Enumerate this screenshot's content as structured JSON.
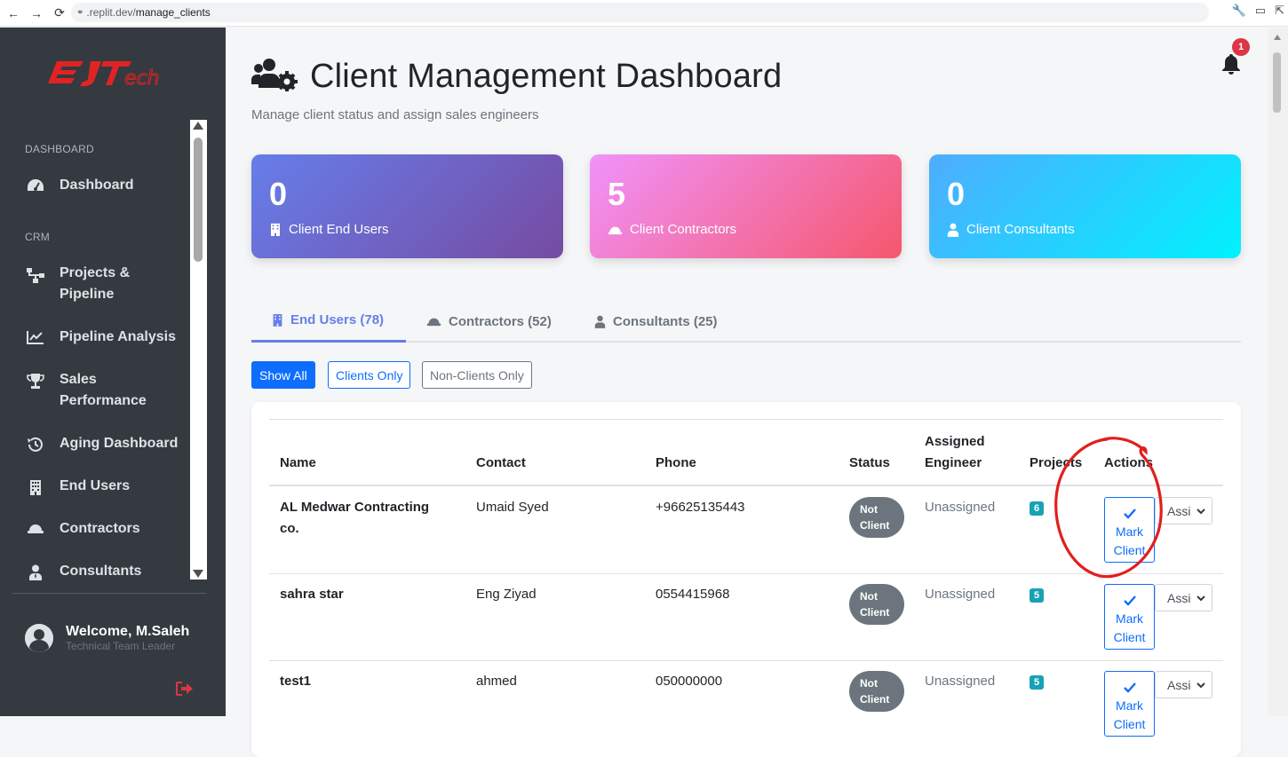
{
  "browser": {
    "url_host": ".replit.dev/",
    "url_path": "manage_clients"
  },
  "sidebar": {
    "logo_text": "EJTech",
    "sections": [
      {
        "label": "DASHBOARD"
      },
      {
        "label": "CRM"
      }
    ],
    "items": [
      {
        "label": "Dashboard",
        "icon": "gauge-icon"
      },
      {
        "label": "Projects & Pipeline",
        "line1": "Projects &",
        "line2": "Pipeline",
        "icon": "sitemap-icon"
      },
      {
        "label": "Pipeline Analysis",
        "icon": "chart-line-icon"
      },
      {
        "label": "Sales Performance",
        "line1": "Sales",
        "line2": "Performance",
        "icon": "trophy-icon"
      },
      {
        "label": "Aging Dashboard",
        "icon": "history-icon"
      },
      {
        "label": "End Users",
        "icon": "building-icon"
      },
      {
        "label": "Contractors",
        "icon": "hard-hat-icon"
      },
      {
        "label": "Consultants",
        "icon": "user-tie-icon"
      }
    ],
    "user": {
      "welcome": "Welcome, M.Saleh",
      "role": "Technical Team Leader"
    }
  },
  "header": {
    "title": "Client Management Dashboard",
    "subtitle": "Manage client status and assign sales engineers",
    "notification_count": "1"
  },
  "stats": [
    {
      "value": "0",
      "label": "Client End Users",
      "icon": "building-icon"
    },
    {
      "value": "5",
      "label": "Client Contractors",
      "icon": "hard-hat-icon"
    },
    {
      "value": "0",
      "label": "Client Consultants",
      "icon": "user-tie-icon"
    }
  ],
  "tabs": [
    {
      "label": "End Users (78)",
      "active": true
    },
    {
      "label": "Contractors (52)",
      "active": false
    },
    {
      "label": "Consultants (25)",
      "active": false
    }
  ],
  "filters": {
    "show_all": "Show All",
    "clients_only": "Clients Only",
    "non_clients_only": "Non-Clients Only"
  },
  "table": {
    "headers": {
      "name": "Name",
      "contact": "Contact",
      "phone": "Phone",
      "status": "Status",
      "assigned_line1": "Assigned",
      "assigned_line2": "Engineer",
      "projects": "Projects",
      "actions": "Actions"
    },
    "rows": [
      {
        "name_line1": "AL Medwar Contracting",
        "name_line2": "co.",
        "contact": "Umaid Syed",
        "phone": "+96625135443",
        "status_line1": "Not",
        "status_line2": "Client",
        "engineer": "Unassigned",
        "projects": "6",
        "action_line1": "Mark",
        "action_line2": "Client",
        "assign": "Assi"
      },
      {
        "name_line1": "sahra star",
        "name_line2": "",
        "contact": "Eng Ziyad",
        "phone": "0554415968",
        "status_line1": "Not",
        "status_line2": "Client",
        "engineer": "Unassigned",
        "projects": "5",
        "action_line1": "Mark",
        "action_line2": "Client",
        "assign": "Assi"
      },
      {
        "name_line1": "test1",
        "name_line2": "",
        "contact": "ahmed",
        "phone": "050000000",
        "status_line1": "Not",
        "status_line2": "Client",
        "engineer": "Unassigned",
        "projects": "5",
        "action_line1": "Mark",
        "action_line2": "Client",
        "assign": "Assi"
      }
    ]
  },
  "colors": {
    "primary": "#0d6efd",
    "tab_active": "#667eea",
    "sidebar_bg": "#343a40",
    "badge_info": "#17a2b8",
    "status_gray": "#6c757d",
    "notification_red": "#dc3545",
    "annotation_red": "#e0201e"
  }
}
